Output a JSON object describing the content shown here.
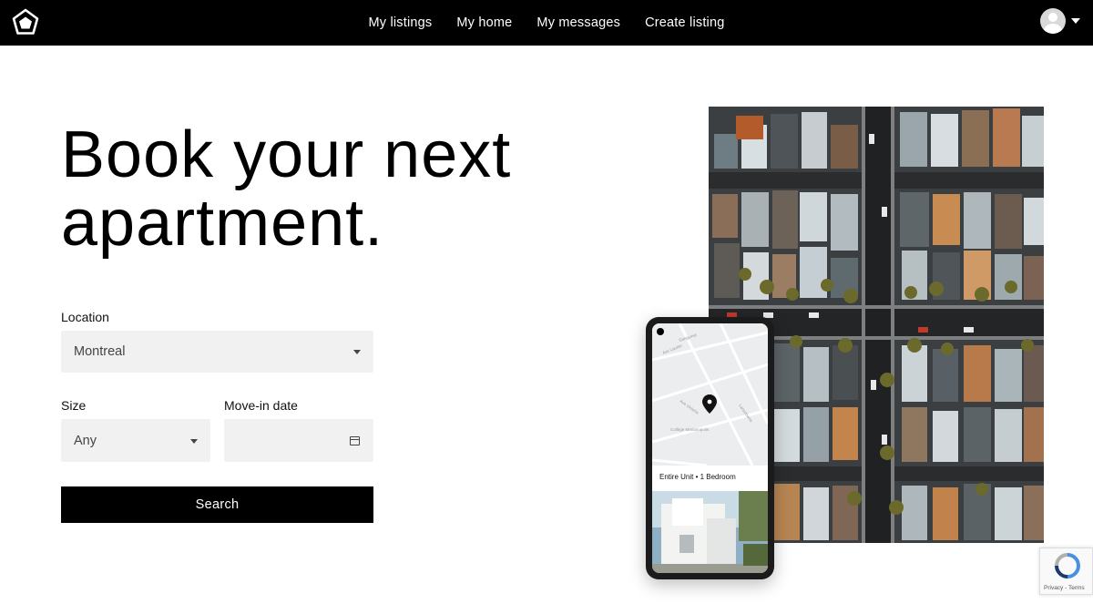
{
  "nav": {
    "links": [
      "My listings",
      "My home",
      "My messages",
      "Create listing"
    ]
  },
  "hero": {
    "title_line1": "Book your next",
    "title_line2": "apartment."
  },
  "form": {
    "location_label": "Location",
    "location_value": "Montreal",
    "size_label": "Size",
    "size_value": "Any",
    "movein_label": "Move-in date",
    "movein_value": "",
    "search_label": "Search"
  },
  "phone": {
    "listing_label": "Entire Unit • 1 Bedroom",
    "map_labels": [
      "Sanguinet",
      "Ave Laurier",
      "Ave Victoria",
      "Collège Marianopolis",
      "Lansdowne"
    ]
  },
  "recaptcha": {
    "text": "Privacy - Terms"
  },
  "colors": {
    "nav_bg": "#000000",
    "button_bg": "#000000",
    "field_bg": "#f1f1f1"
  }
}
